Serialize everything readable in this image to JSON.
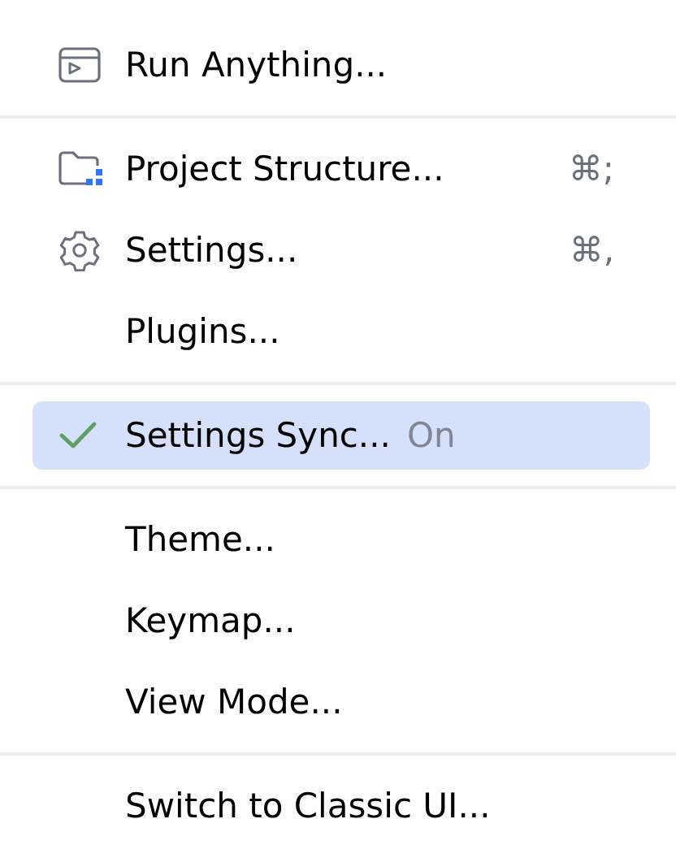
{
  "menu": {
    "groups": [
      {
        "items": [
          {
            "kind": "run",
            "label": "Run Anything...",
            "selected": false
          }
        ]
      },
      {
        "items": [
          {
            "kind": "structure",
            "label": "Project Structure...",
            "shortcut": "⌘;",
            "selected": false
          },
          {
            "kind": "settings",
            "label": "Settings...",
            "shortcut": "⌘,",
            "selected": false
          },
          {
            "kind": "plain",
            "label": "Plugins...",
            "selected": false
          }
        ]
      },
      {
        "items": [
          {
            "kind": "plain",
            "label": "Settings Sync...",
            "status": "On",
            "checked": true,
            "selected": true
          }
        ]
      },
      {
        "items": [
          {
            "kind": "plain",
            "label": "Theme...",
            "selected": false
          },
          {
            "kind": "plain",
            "label": "Keymap...",
            "selected": false
          },
          {
            "kind": "plain",
            "label": "View Mode...",
            "selected": false
          }
        ]
      },
      {
        "items": [
          {
            "kind": "plain",
            "label": "Switch to Classic UI...",
            "selected": false
          }
        ]
      }
    ]
  }
}
